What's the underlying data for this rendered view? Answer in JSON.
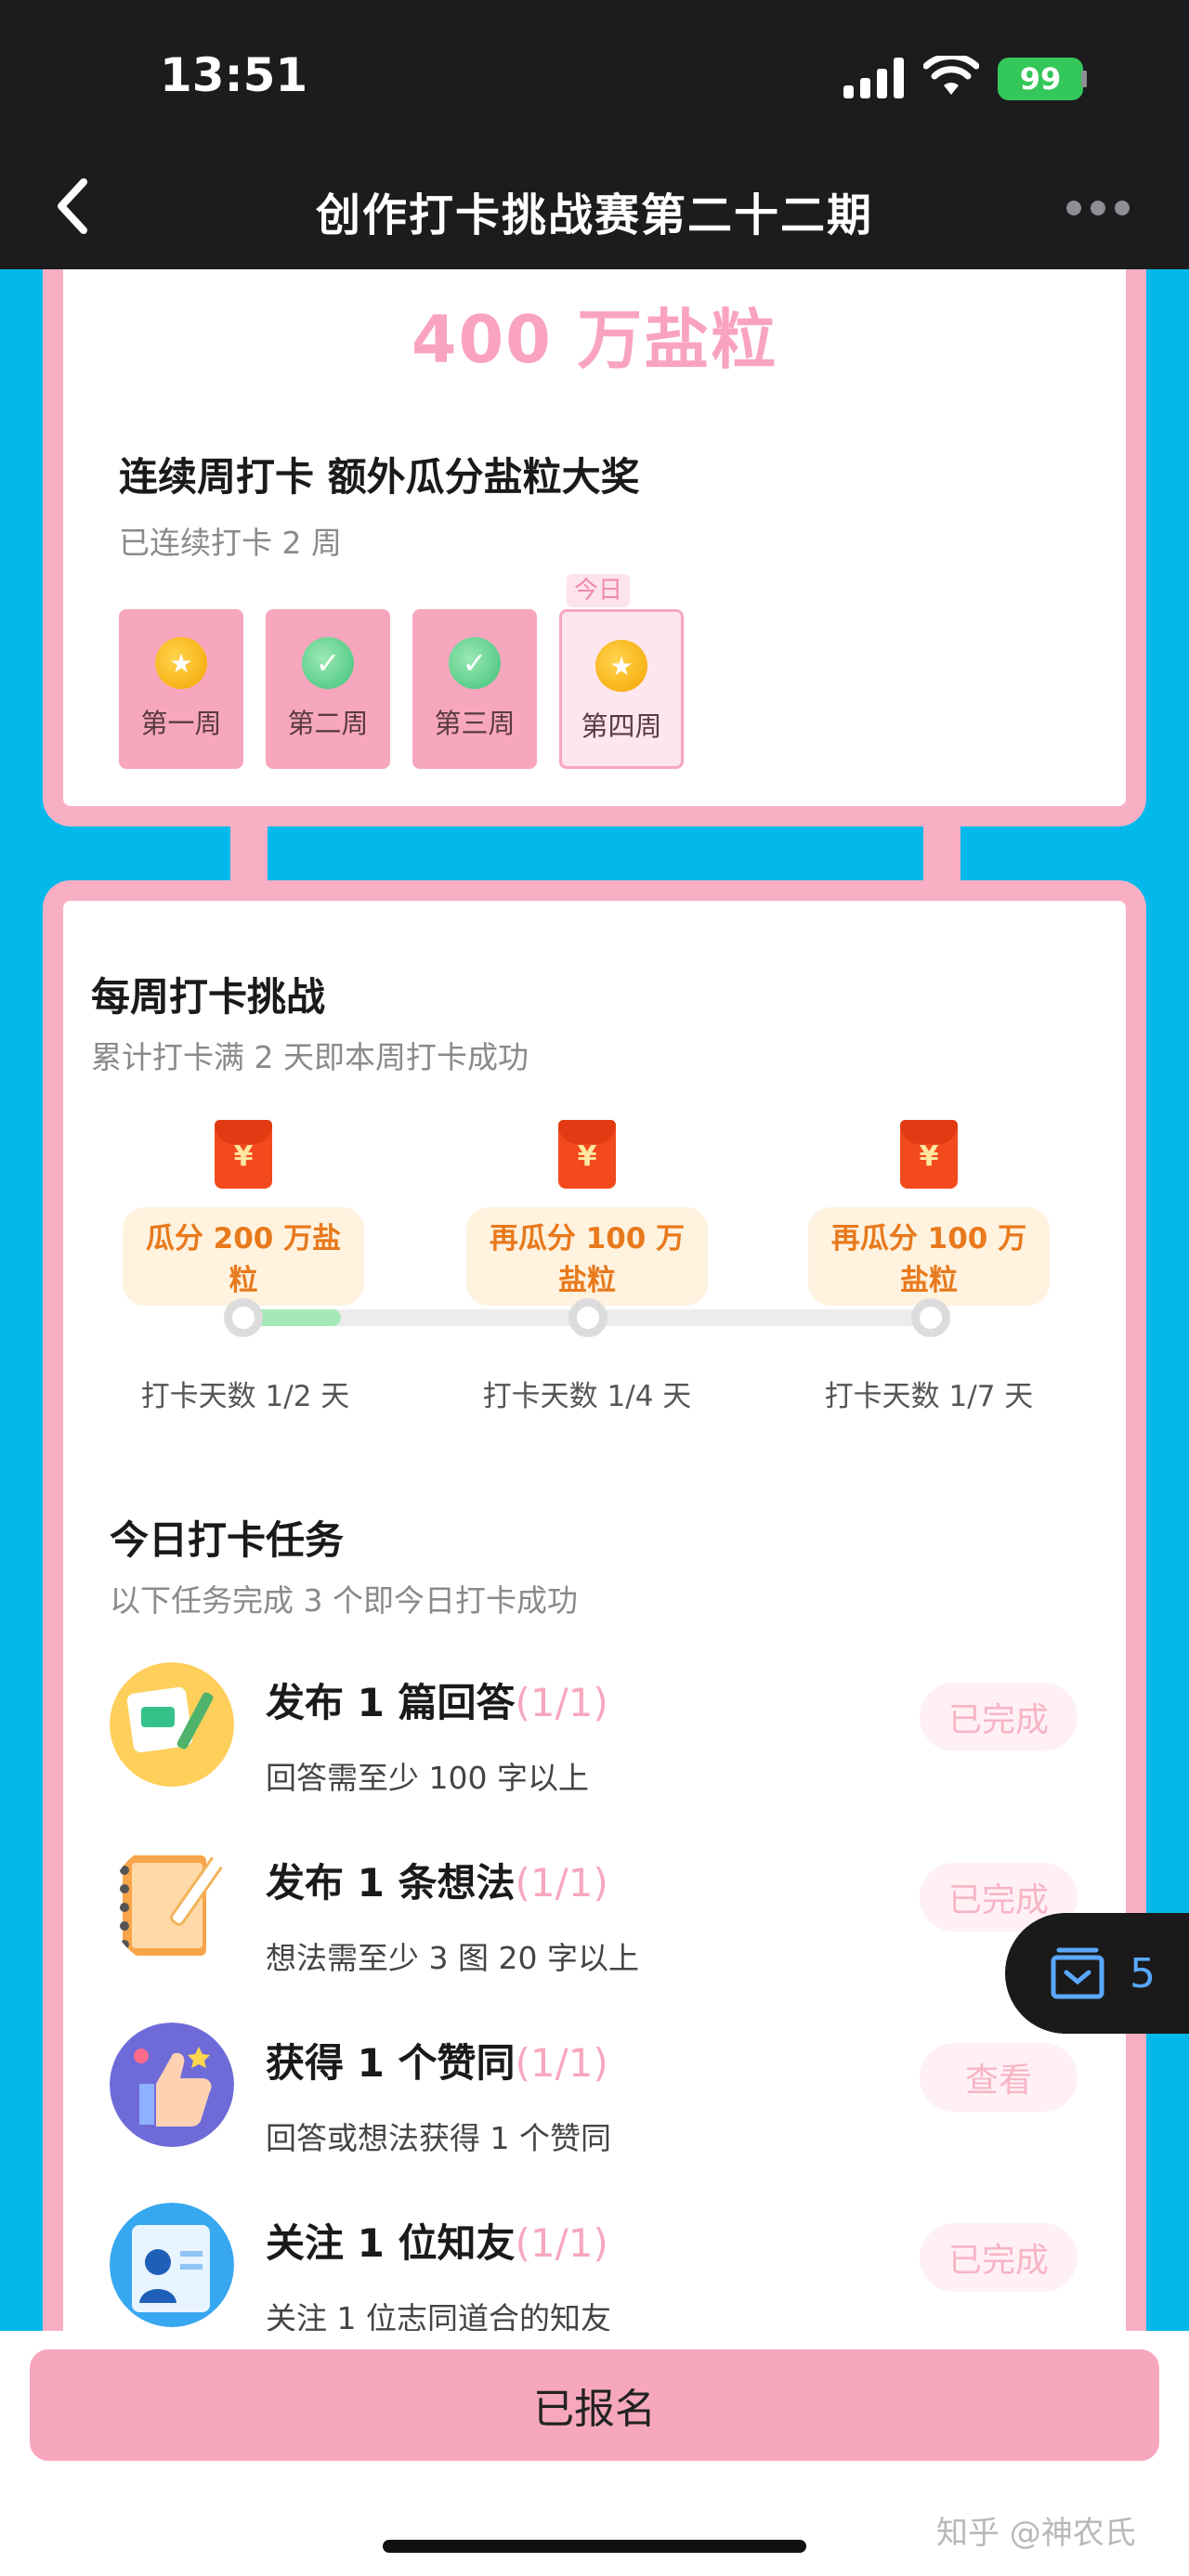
{
  "status": {
    "time": "13:51",
    "battery": "99"
  },
  "nav": {
    "title": "创作打卡挑战赛第二十二期"
  },
  "prize": {
    "amount": "400 万盐粒"
  },
  "consecutive": {
    "title": "连续周打卡 额外瓜分盐粒大奖",
    "subtitle": "已连续打卡 2 周",
    "today_tag": "今日",
    "weeks": [
      {
        "label": "第一周",
        "icon": "coin-icon"
      },
      {
        "label": "第二周",
        "icon": "check-icon"
      },
      {
        "label": "第三周",
        "icon": "check-icon"
      },
      {
        "label": "第四周",
        "icon": "coin-icon"
      }
    ]
  },
  "weekly": {
    "title": "每周打卡挑战",
    "subtitle": "累计打卡满 2 天即本周打卡成功",
    "tiers": [
      {
        "reward": "瓜分 200 万盐粒",
        "days": "打卡天数 1/2 天"
      },
      {
        "reward": "再瓜分 100 万盐粒",
        "days": "打卡天数 1/4 天"
      },
      {
        "reward": "再瓜分 100 万盐粒",
        "days": "打卡天数 1/7 天"
      }
    ],
    "progress_fraction": 0.5
  },
  "daily": {
    "title": "今日打卡任务",
    "subtitle": "以下任务完成 3 个即今日打卡成功",
    "tasks": [
      {
        "title": "发布 1 篇回答",
        "progress": "(1/1)",
        "desc": "回答需至少 100 字以上",
        "button": "已完成"
      },
      {
        "title": "发布 1 条想法",
        "progress": "(1/1)",
        "desc": "想法需至少 3 图 20 字以上",
        "button": "已完成"
      },
      {
        "title": "获得 1 个赞同",
        "progress": "(1/1)",
        "desc": "回答或想法获得 1 个赞同",
        "button": "查看"
      },
      {
        "title": "关注 1 位知友",
        "progress": "(1/1)",
        "desc": "关注 1 位志同道合的知友",
        "button": "已完成"
      }
    ]
  },
  "side_widget": {
    "count": "5"
  },
  "footer": {
    "signup": "已报名",
    "watermark": "知乎 @神农氏"
  },
  "colors": {
    "accent_pink": "#f7a7bd",
    "background_blue": "#03b9ec",
    "reward_orange": "#e8791c"
  }
}
